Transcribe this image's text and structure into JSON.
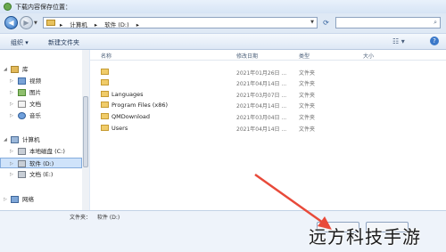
{
  "window": {
    "title": "下载内容保存位置："
  },
  "address": {
    "crumbs": [
      "计算机",
      "▸",
      "软件 (D:)",
      "▸"
    ],
    "search_placeholder": ""
  },
  "toolbar": {
    "organize_label": "组织 ▾",
    "new_folder_label": "新建文件夹"
  },
  "nav": {
    "items": [
      {
        "label": "库",
        "icon": "library-icon"
      },
      {
        "label": "视频",
        "icon": "video-icon"
      },
      {
        "label": "图片",
        "icon": "picture-icon"
      },
      {
        "label": "文档",
        "icon": "document-icon"
      },
      {
        "label": "音乐",
        "icon": "music-icon"
      },
      {
        "label": "计算机",
        "icon": "computer-icon"
      },
      {
        "label": "本地磁盘 (C:)",
        "icon": "drive-icon"
      },
      {
        "label": "软件 (D:)",
        "icon": "drive-icon"
      },
      {
        "label": "文档 (E:)",
        "icon": "drive-icon"
      },
      {
        "label": "网络",
        "icon": "network-icon"
      }
    ]
  },
  "list": {
    "headers": {
      "name": "名称",
      "modified": "修改日期",
      "type": "类型",
      "size": "大小"
    },
    "rows": [
      {
        "name": "",
        "modified": "2021年01月26日 ...",
        "type": "文件夹"
      },
      {
        "name": "",
        "modified": "2021年04月14日 ...",
        "type": "文件夹"
      },
      {
        "name": "Languages",
        "modified": "2021年03月07日 ...",
        "type": "文件夹"
      },
      {
        "name": "Program Files (x86)",
        "modified": "2021年04月14日 ...",
        "type": "文件夹"
      },
      {
        "name": "QMDownload",
        "modified": "2021年03月04日 ...",
        "type": "文件夹"
      },
      {
        "name": "Users",
        "modified": "2021年04月14日 ...",
        "type": "文件夹"
      }
    ]
  },
  "bottom": {
    "folder_label": "文件夹：",
    "folder_value": "软件 (D:)"
  },
  "watermark": "远方科技手游",
  "colors": {
    "accent": "#3a78c9",
    "folder": "#f0cc6a",
    "annotation": "#e84a3a"
  }
}
